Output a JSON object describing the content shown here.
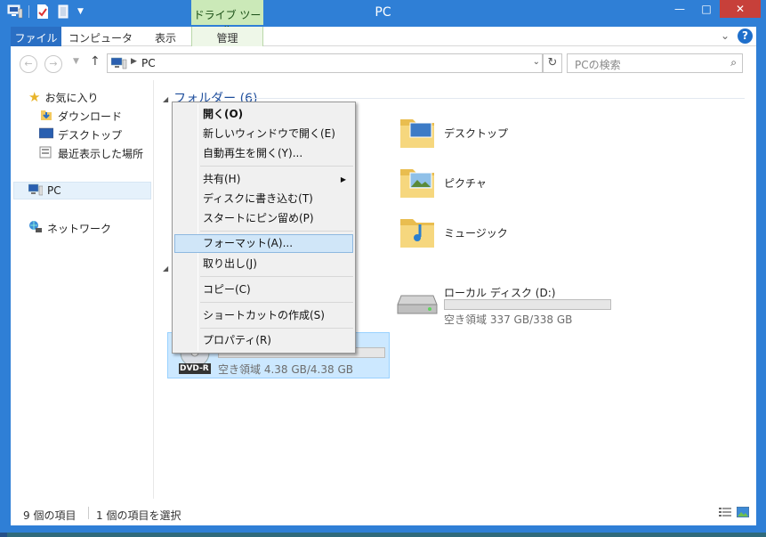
{
  "window": {
    "title": "PC",
    "context_tab_group": "ドライブ ツール",
    "controls": {
      "minimize": "—",
      "maximize": "□",
      "close": "✕"
    }
  },
  "ribbon": {
    "tabs": [
      "ファイル",
      "コンピューター",
      "表示",
      "管理"
    ],
    "help": "?"
  },
  "navigation": {
    "back": "←",
    "forward": "→",
    "up": "↑",
    "address": "PC",
    "refresh": "↻",
    "search_placeholder": "PCの検索"
  },
  "sidebar": {
    "favorites": "お気に入り",
    "favorites_items": [
      "ダウンロード",
      "デスクトップ",
      "最近表示した場所"
    ],
    "pc": "PC",
    "network": "ネットワーク"
  },
  "content": {
    "folders_header": "フォルダー (6)",
    "folders": [
      "デスクトップ",
      "ピクチャ",
      "ミュージック"
    ],
    "drives": [
      {
        "name": "ローカル ディスク (D:)",
        "free": "空き領域 337 GB/338 GB",
        "used_fraction": 0.003
      },
      {
        "label": "DVD-R",
        "free": "空き領域 4.38 GB/4.38 GB",
        "used_fraction": 0.0
      }
    ]
  },
  "context_menu": {
    "items": [
      {
        "label": "開く(O)",
        "bold": true
      },
      {
        "label": "新しいウィンドウで開く(E)"
      },
      {
        "label": "自動再生を開く(Y)..."
      },
      {
        "label": "共有(H)",
        "submenu": true
      },
      {
        "label": "ディスクに書き込む(T)"
      },
      {
        "label": "スタートにピン留め(P)"
      },
      {
        "label": "フォーマット(A)...",
        "highlighted": true
      },
      {
        "label": "取り出し(J)"
      },
      {
        "label": "コピー(C)"
      },
      {
        "label": "ショートカットの作成(S)"
      },
      {
        "label": "プロパティ(R)"
      }
    ]
  },
  "status": {
    "item_count": "9 個の項目",
    "selection": "1 個の項目を選択"
  },
  "colors": {
    "frame": "#2f7fd6",
    "file_tab": "#2a6fc4",
    "context_tab": "#cbe9b8",
    "close": "#c7403a",
    "selection": "#cce8ff",
    "menu_highlight": "#d0e6f8"
  }
}
